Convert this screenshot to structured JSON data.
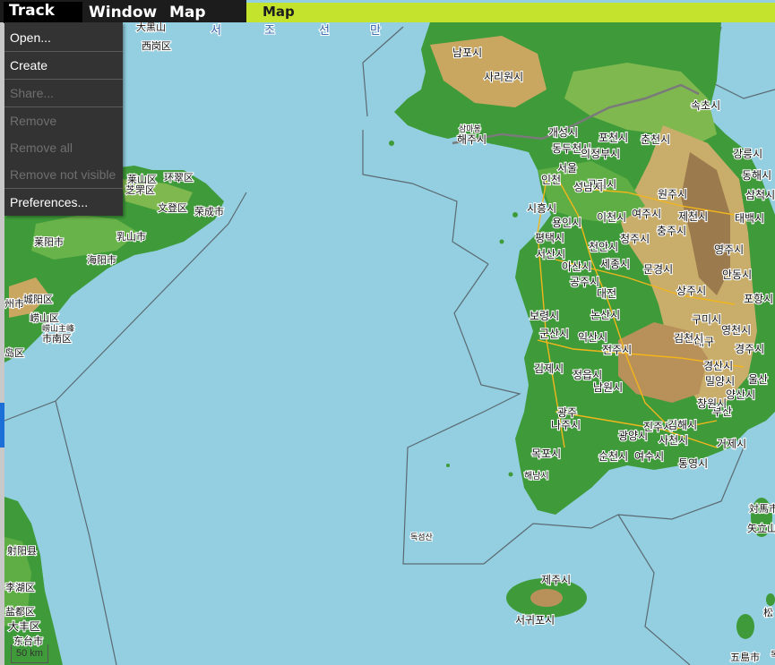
{
  "menubar": {
    "track": "Track",
    "window": "Window",
    "map": "Map"
  },
  "map_header": {
    "label": "Map"
  },
  "track_menu": {
    "items": [
      {
        "label": "Open...",
        "enabled": true
      },
      {
        "label": "Create",
        "enabled": true
      },
      {
        "label": "Share...",
        "enabled": false
      },
      {
        "label": "Remove",
        "enabled": false
      },
      {
        "label": "Remove all",
        "enabled": false
      },
      {
        "label": "Remove not visible",
        "enabled": false
      },
      {
        "label": "Preferences...",
        "enabled": true
      }
    ]
  },
  "map": {
    "scale": "50 km",
    "annotation_color": "#e01b1b",
    "colors": {
      "sea": "#93cfe0",
      "lowland": "#3f9b3a",
      "hills": "#d8c07a",
      "mountains": "#9b7a4e",
      "roads": "#f2b51c",
      "borders": "#555555"
    },
    "labels": {
      "sea": [
        "서",
        "조",
        "선",
        "만"
      ],
      "china": [
        "西岗区",
        "大黑山",
        "莱山区",
        "环翠区",
        "芝罘区",
        "文登区",
        "荣成市",
        "莱阳市",
        "乳山市",
        "海阳市",
        "州市",
        "城阳区",
        "崂山区",
        "崂山主峰",
        "市南区",
        "岛区",
        "射阳县",
        "李湖区",
        "盐都区",
        "大丰区",
        "东台市"
      ],
      "north_korea": [
        "남포시",
        "사리원시",
        "해주시",
        "개성시",
        "삼마봉"
      ],
      "south_korea": [
        "인천",
        "서울",
        "시흥시",
        "용인시",
        "평택시",
        "춘천시",
        "포천시",
        "동두천시",
        "의정부시",
        "구리시",
        "성남시",
        "이천시",
        "여주시",
        "원주시",
        "제천시",
        "충주시",
        "천안시",
        "아산시",
        "서산시",
        "공주시",
        "대전",
        "보령시",
        "논산시",
        "군산시",
        "익산시",
        "전주시",
        "김제시",
        "정읍시",
        "남원시",
        "광주",
        "나주시",
        "목포시",
        "해남시",
        "순천시",
        "광양시",
        "여수시",
        "진주시",
        "사천시",
        "김해시",
        "부산",
        "울산",
        "거제시",
        "통영시",
        "창원시",
        "대구",
        "경산시",
        "영천시",
        "경주시",
        "포항시",
        "구미시",
        "김천시",
        "상주시",
        "문경시",
        "안동시",
        "영주시",
        "강릉시",
        "동해시",
        "삼척시",
        "속초시",
        "태백시",
        "밀양시",
        "양산시",
        "청주시",
        "세종시",
        "제주시",
        "서귀포시",
        "독도",
        "독섬산"
      ],
      "japan": [
        "対馬市",
        "矢立山",
        "五島市",
        "松"
      ]
    }
  }
}
